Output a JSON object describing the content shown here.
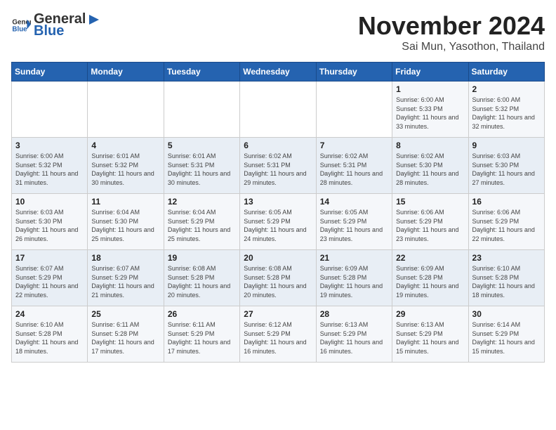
{
  "header": {
    "logo_general": "General",
    "logo_blue": "Blue",
    "month_year": "November 2024",
    "location": "Sai Mun, Yasothon, Thailand"
  },
  "days_of_week": [
    "Sunday",
    "Monday",
    "Tuesday",
    "Wednesday",
    "Thursday",
    "Friday",
    "Saturday"
  ],
  "weeks": [
    [
      {
        "day": "",
        "info": ""
      },
      {
        "day": "",
        "info": ""
      },
      {
        "day": "",
        "info": ""
      },
      {
        "day": "",
        "info": ""
      },
      {
        "day": "",
        "info": ""
      },
      {
        "day": "1",
        "info": "Sunrise: 6:00 AM\nSunset: 5:33 PM\nDaylight: 11 hours and 33 minutes."
      },
      {
        "day": "2",
        "info": "Sunrise: 6:00 AM\nSunset: 5:32 PM\nDaylight: 11 hours and 32 minutes."
      }
    ],
    [
      {
        "day": "3",
        "info": "Sunrise: 6:00 AM\nSunset: 5:32 PM\nDaylight: 11 hours and 31 minutes."
      },
      {
        "day": "4",
        "info": "Sunrise: 6:01 AM\nSunset: 5:32 PM\nDaylight: 11 hours and 30 minutes."
      },
      {
        "day": "5",
        "info": "Sunrise: 6:01 AM\nSunset: 5:31 PM\nDaylight: 11 hours and 30 minutes."
      },
      {
        "day": "6",
        "info": "Sunrise: 6:02 AM\nSunset: 5:31 PM\nDaylight: 11 hours and 29 minutes."
      },
      {
        "day": "7",
        "info": "Sunrise: 6:02 AM\nSunset: 5:31 PM\nDaylight: 11 hours and 28 minutes."
      },
      {
        "day": "8",
        "info": "Sunrise: 6:02 AM\nSunset: 5:30 PM\nDaylight: 11 hours and 28 minutes."
      },
      {
        "day": "9",
        "info": "Sunrise: 6:03 AM\nSunset: 5:30 PM\nDaylight: 11 hours and 27 minutes."
      }
    ],
    [
      {
        "day": "10",
        "info": "Sunrise: 6:03 AM\nSunset: 5:30 PM\nDaylight: 11 hours and 26 minutes."
      },
      {
        "day": "11",
        "info": "Sunrise: 6:04 AM\nSunset: 5:30 PM\nDaylight: 11 hours and 25 minutes."
      },
      {
        "day": "12",
        "info": "Sunrise: 6:04 AM\nSunset: 5:29 PM\nDaylight: 11 hours and 25 minutes."
      },
      {
        "day": "13",
        "info": "Sunrise: 6:05 AM\nSunset: 5:29 PM\nDaylight: 11 hours and 24 minutes."
      },
      {
        "day": "14",
        "info": "Sunrise: 6:05 AM\nSunset: 5:29 PM\nDaylight: 11 hours and 23 minutes."
      },
      {
        "day": "15",
        "info": "Sunrise: 6:06 AM\nSunset: 5:29 PM\nDaylight: 11 hours and 23 minutes."
      },
      {
        "day": "16",
        "info": "Sunrise: 6:06 AM\nSunset: 5:29 PM\nDaylight: 11 hours and 22 minutes."
      }
    ],
    [
      {
        "day": "17",
        "info": "Sunrise: 6:07 AM\nSunset: 5:29 PM\nDaylight: 11 hours and 22 minutes."
      },
      {
        "day": "18",
        "info": "Sunrise: 6:07 AM\nSunset: 5:29 PM\nDaylight: 11 hours and 21 minutes."
      },
      {
        "day": "19",
        "info": "Sunrise: 6:08 AM\nSunset: 5:28 PM\nDaylight: 11 hours and 20 minutes."
      },
      {
        "day": "20",
        "info": "Sunrise: 6:08 AM\nSunset: 5:28 PM\nDaylight: 11 hours and 20 minutes."
      },
      {
        "day": "21",
        "info": "Sunrise: 6:09 AM\nSunset: 5:28 PM\nDaylight: 11 hours and 19 minutes."
      },
      {
        "day": "22",
        "info": "Sunrise: 6:09 AM\nSunset: 5:28 PM\nDaylight: 11 hours and 19 minutes."
      },
      {
        "day": "23",
        "info": "Sunrise: 6:10 AM\nSunset: 5:28 PM\nDaylight: 11 hours and 18 minutes."
      }
    ],
    [
      {
        "day": "24",
        "info": "Sunrise: 6:10 AM\nSunset: 5:28 PM\nDaylight: 11 hours and 18 minutes."
      },
      {
        "day": "25",
        "info": "Sunrise: 6:11 AM\nSunset: 5:28 PM\nDaylight: 11 hours and 17 minutes."
      },
      {
        "day": "26",
        "info": "Sunrise: 6:11 AM\nSunset: 5:29 PM\nDaylight: 11 hours and 17 minutes."
      },
      {
        "day": "27",
        "info": "Sunrise: 6:12 AM\nSunset: 5:29 PM\nDaylight: 11 hours and 16 minutes."
      },
      {
        "day": "28",
        "info": "Sunrise: 6:13 AM\nSunset: 5:29 PM\nDaylight: 11 hours and 16 minutes."
      },
      {
        "day": "29",
        "info": "Sunrise: 6:13 AM\nSunset: 5:29 PM\nDaylight: 11 hours and 15 minutes."
      },
      {
        "day": "30",
        "info": "Sunrise: 6:14 AM\nSunset: 5:29 PM\nDaylight: 11 hours and 15 minutes."
      }
    ]
  ]
}
